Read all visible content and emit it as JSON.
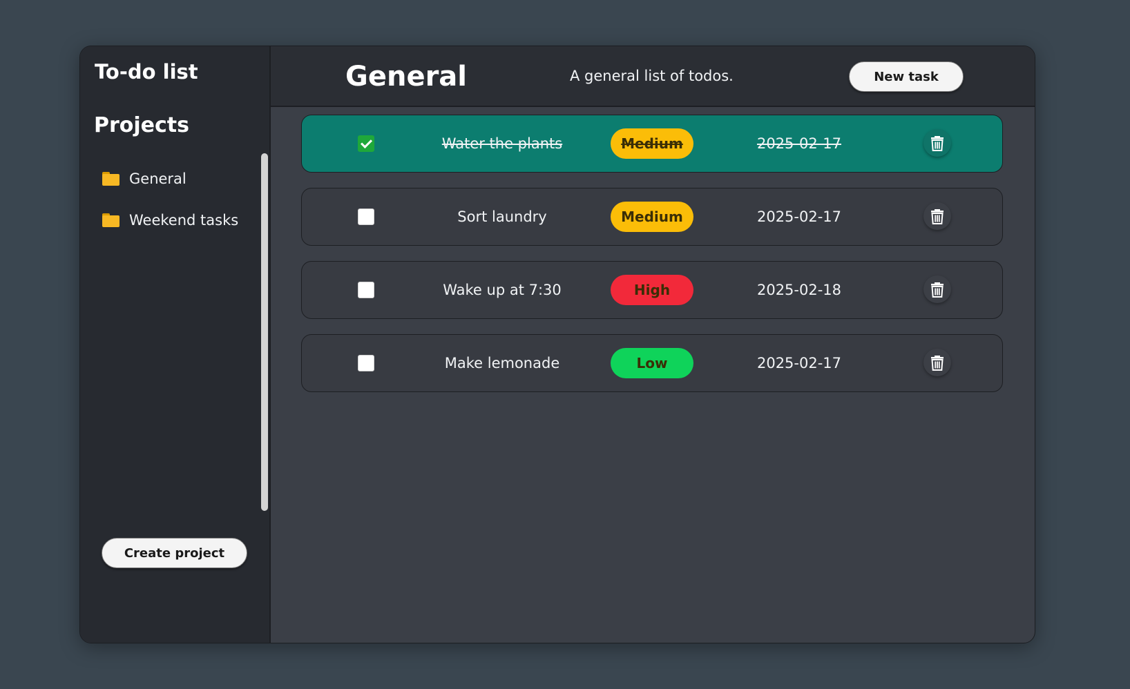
{
  "sidebar": {
    "title": "To-do list",
    "projects_heading": "Projects",
    "projects": [
      {
        "label": "General",
        "icon": "folder-icon"
      },
      {
        "label": "Weekend tasks",
        "icon": "folder-icon"
      }
    ],
    "create_project_label": "Create project"
  },
  "header": {
    "project_title": "General",
    "project_description": "A general list of todos.",
    "new_task_label": "New task"
  },
  "tasks": [
    {
      "name": "Water the plants",
      "priority": "Medium",
      "date": "2025-02-17",
      "completed": true
    },
    {
      "name": "Sort laundry",
      "priority": "Medium",
      "date": "2025-02-17",
      "completed": false
    },
    {
      "name": "Wake up at 7:30",
      "priority": "High",
      "date": "2025-02-18",
      "completed": false
    },
    {
      "name": "Make lemonade",
      "priority": "Low",
      "date": "2025-02-17",
      "completed": false
    }
  ],
  "colors": {
    "completed_row": "#0c7d6f",
    "priority_medium": "#fbbd08",
    "priority_high": "#f2293a",
    "priority_low": "#0fd35a",
    "checkbox_checked": "#1fa83a"
  }
}
